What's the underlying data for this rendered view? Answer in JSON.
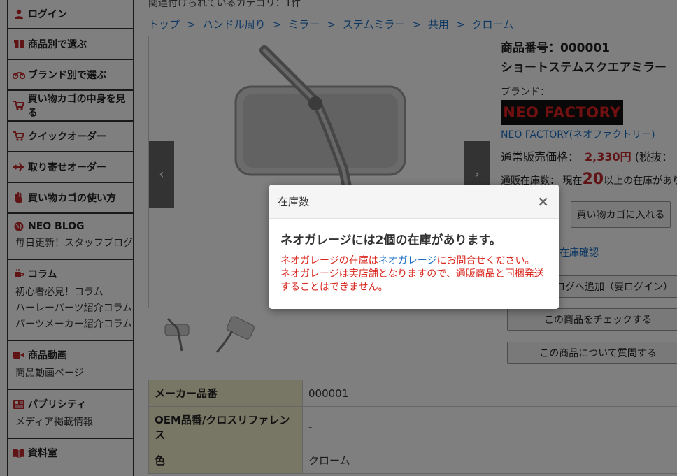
{
  "sidebar": {
    "items": [
      {
        "label": "ログイン",
        "icon": "user-icon"
      },
      {
        "label": "商品別で選ぶ",
        "icon": "box-icon"
      },
      {
        "label": "ブランド別で選ぶ",
        "icon": "motorcycle-icon"
      },
      {
        "label": "買い物カゴの中身を見る",
        "icon": "cart-icon"
      },
      {
        "label": "クイックオーダー",
        "icon": "cart-icon"
      },
      {
        "label": "取り寄せオーダー",
        "icon": "plane-icon"
      },
      {
        "label": "買い物カゴの使い方",
        "icon": "hand-icon"
      }
    ],
    "groups": [
      {
        "title": "NEO BLOG",
        "icon": "globe-icon",
        "links": [
          "毎日更新！スタッフブログ"
        ]
      },
      {
        "title": "コラム",
        "icon": "coffee-icon",
        "links": [
          "初心者必見！コラム",
          "ハーレーパーツ紹介コラム",
          "パーツメーカー紹介コラム"
        ]
      },
      {
        "title": "商品動画",
        "icon": "video-icon",
        "links": [
          "商品動画ページ"
        ]
      },
      {
        "title": "パブリシティ",
        "icon": "newspaper-icon",
        "links": [
          "メディア掲載情報"
        ]
      },
      {
        "title": "資料室",
        "icon": "book-icon",
        "links": []
      }
    ]
  },
  "category_line": "関連付けられているカテゴリ：1件",
  "breadcrumb": [
    "トップ",
    "ハンドル周り",
    "ミラー",
    "ステムミラー",
    "共用",
    "クローム"
  ],
  "product": {
    "id_line": "商品番号：000001",
    "name": "ショートステムスクエアミラー",
    "brand_label": "ブランド：",
    "brand_logo": "NEO FACTORY",
    "brand_link": "NEO FACTORY(ネオファクトリー)",
    "price_label": "通常販売価格：",
    "price_value": "2,330円",
    "price_suffix": "(税抜：",
    "stock_label": "通販在庫数：",
    "stock_prefix": "現在",
    "stock_number": "20",
    "stock_suffix": "以上の在庫があり"
  },
  "buttons": {
    "cart": "買い物カゴに入れる",
    "store_stock": "ジの在庫確認",
    "wishlist": "カタログへ追加（要ログイン）",
    "check": "この商品をチェックする",
    "ask": "この商品について質問する"
  },
  "spec": [
    {
      "key": "メーカー品番",
      "value": "000001"
    },
    {
      "key": "OEM品番/クロスリファレンス",
      "value": "-"
    },
    {
      "key": "色",
      "value": "クローム"
    }
  ],
  "modal": {
    "title": "在庫数",
    "close": "×",
    "headline": "ネオガレージには2個の在庫があります。",
    "note_1a": "ネオガレージの在庫は",
    "note_1link": "ネオガレージ",
    "note_1b": "にお問合せください。",
    "note_2": "ネオガレージは実店舗となりますので、通販商品と同梱発送することはできません。"
  },
  "colors": {
    "accent_red": "#c0282c",
    "link_blue": "#1a6fc4",
    "spec_key_bg": "#f1ecc9"
  }
}
